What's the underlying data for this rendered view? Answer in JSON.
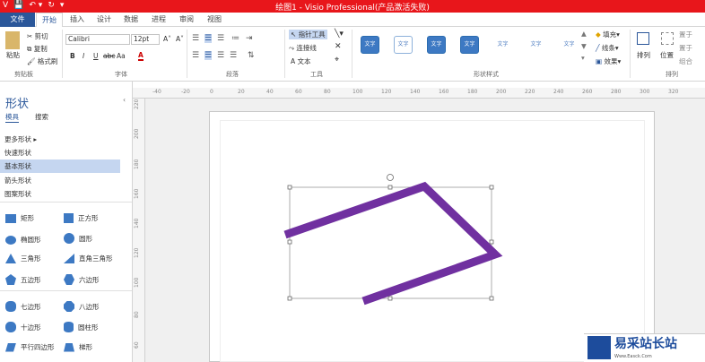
{
  "titlebar": {
    "title": "绘图1 - Visio Professional(产品激活失败)",
    "qat": [
      "V",
      "💾",
      "↶ ▾",
      "↻",
      "▾"
    ]
  },
  "tabs": {
    "file": "文件",
    "home": "开始",
    "insert": "插入",
    "design": "设计",
    "data": "数据",
    "process": "进程",
    "review": "审阅",
    "view": "视图"
  },
  "ribbon": {
    "clipboard": {
      "paste": "粘贴",
      "cut": "剪切",
      "copy": "复制",
      "format_painter": "格式刷",
      "label": "剪贴板"
    },
    "font": {
      "name": "Calibri",
      "size": "12pt",
      "grow": "A˄",
      "shrink": "A˅",
      "bold": "B",
      "italic": "I",
      "underline": "U",
      "strike": "abc",
      "case": "Aa",
      "color": "A",
      "label": "字体"
    },
    "paragraph": {
      "label": "段落"
    },
    "tools": {
      "pointer": "指针工具",
      "connector": "连接线",
      "text": "文本",
      "label": "工具"
    },
    "shape_styles": {
      "samples": [
        "文字",
        "文字",
        "文字",
        "文字",
        "文字",
        "文字",
        "文字"
      ],
      "fill": "填充",
      "line": "线条",
      "effects": "效果",
      "label": "形状样式"
    },
    "arrange": {
      "arrange": "排列",
      "position": "位置",
      "bring_front": "置于",
      "send_back": "置于",
      "group": "组合",
      "label": "排列"
    }
  },
  "panel": {
    "title": "形状",
    "tabs": [
      "模具",
      "搜索"
    ],
    "categories": [
      "更多形状",
      "快速形状",
      "基本形状",
      "箭头形状",
      "图案形状"
    ],
    "shapes": [
      [
        "矩形",
        "正方形"
      ],
      [
        "椭圆形",
        "圆形"
      ],
      [
        "三角形",
        "直角三角形"
      ],
      [
        "五边形",
        "六边形"
      ],
      [
        "七边形",
        "八边形"
      ],
      [
        "十边形",
        "圆柱形"
      ],
      [
        "平行四边形",
        "梯形"
      ]
    ]
  },
  "ruler": {
    "h": [
      "-40",
      "-20",
      "0",
      "20",
      "40",
      "60",
      "80",
      "100",
      "120",
      "140",
      "160",
      "180",
      "200",
      "220",
      "240",
      "260",
      "280",
      "300",
      "320"
    ],
    "v": [
      "220",
      "200",
      "180",
      "160",
      "140",
      "120",
      "100",
      "80",
      "60"
    ]
  },
  "shape_color": "#7030a0",
  "watermark": {
    "title": "易采站长站",
    "sub": "Www.Easck.Com"
  }
}
